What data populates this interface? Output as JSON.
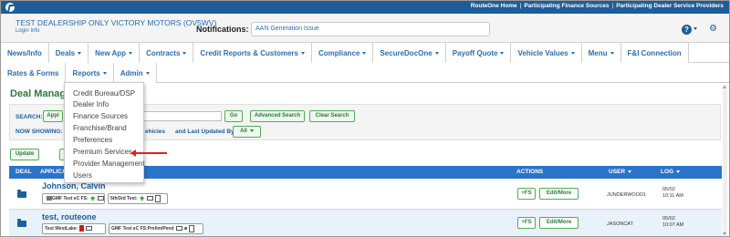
{
  "topbar": {
    "links": [
      "RouteOne Home",
      "Participating Finance Sources",
      "Participating Dealer Service Providers"
    ],
    "separator": "|"
  },
  "header": {
    "dealer_name": "TEST DEALERSHIP ONLY VICTORY MOTORS  (OV5WV)",
    "login_info": "Login Info",
    "notifications_label": "Notifications:",
    "notification_text": "AAN Generation Issue",
    "help_icon": "question-circle-icon",
    "gear_icon": "gear-icon",
    "power_icon": "power-icon"
  },
  "nav": {
    "row1": [
      {
        "label": "News/Info",
        "caret": false
      },
      {
        "label": "Deals",
        "caret": true
      },
      {
        "label": "New App",
        "caret": true
      },
      {
        "label": "Contracts",
        "caret": true
      },
      {
        "label": "Credit Reports & Customers",
        "caret": true
      },
      {
        "label": "Compliance",
        "caret": true
      },
      {
        "label": "SecureDocOne",
        "caret": true
      },
      {
        "label": "Payoff Quote",
        "caret": true
      },
      {
        "label": "Vehicle Values",
        "caret": true
      },
      {
        "label": "Menu",
        "caret": true
      },
      {
        "label": "F&I Connection",
        "caret": false
      }
    ],
    "row2": [
      {
        "label": "Rates & Forms",
        "caret": false
      },
      {
        "label": "Reports",
        "caret": true
      },
      {
        "label": "Admin",
        "caret": true
      }
    ]
  },
  "page": {
    "title": "Deal Manag",
    "search_label": "SEARCH:",
    "apply_label": "Appl",
    "go_label": "Go",
    "advanced_search": "Advanced Search",
    "clear_search": "Clear Search",
    "now_showing": "NOW SHOWING:",
    "vehicles_text": "ehicles",
    "last_updated_text": "and Last Updated By",
    "all_label": "All",
    "update_label": "Update"
  },
  "dropdown": {
    "items": [
      "Credit Bureau/DSP",
      "Dealer Info",
      "Finance Sources",
      "Franchise/Brand",
      "Preferences",
      "Premium Services",
      "Provider Management",
      "Users"
    ]
  },
  "table": {
    "headers": {
      "deal": "DEAL",
      "applicant": "APPLICA",
      "actions": "ACTIONS",
      "user": "USER",
      "log": "LOG"
    },
    "rows": [
      {
        "applicant": "Johnson, Calvin",
        "sources": [
          "GMF Test eC FS:",
          "5th/3rd Test:"
        ],
        "fs_label": "+FS",
        "edit_label": "Edit/More",
        "user": "JUNDERWOOD1",
        "log_date": "05/02",
        "log_time": "10:11 AM"
      },
      {
        "applicant": "test, routeone",
        "sources": [
          "Test WestLake:",
          "GMF Test eC FS:",
          "Prelim/Pend"
        ],
        "fs_label": "+FS",
        "edit_label": "Edit/More",
        "user": "JASONCAT",
        "log_date": "05/02",
        "log_time": "10:07 AM"
      }
    ]
  }
}
